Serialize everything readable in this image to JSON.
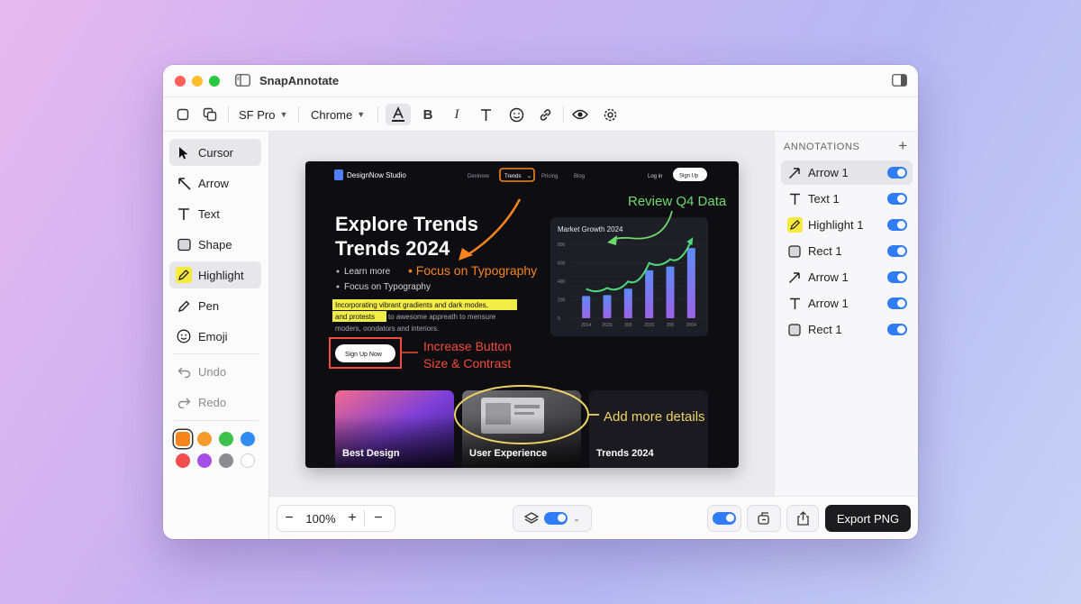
{
  "app": {
    "title": "SnapAnnotate"
  },
  "toolbar": {
    "font_family": "SF Pro",
    "browser_frame": "Chrome"
  },
  "tools": [
    {
      "label": "Cursor",
      "icon": "cursor-icon"
    },
    {
      "label": "Arrow",
      "icon": "arrow-icon"
    },
    {
      "label": "Text",
      "icon": "text-icon"
    },
    {
      "label": "Shape",
      "icon": "shape-icon"
    },
    {
      "label": "Highlight",
      "icon": "highlight-icon"
    },
    {
      "label": "Pen",
      "icon": "pen-icon"
    },
    {
      "label": "Emoji",
      "icon": "emoji-icon"
    }
  ],
  "history": {
    "undo": "Undo",
    "redo": "Redo"
  },
  "colors": {
    "swatches": [
      "#f7851d",
      "#f79a2e",
      "#3ec14a",
      "#2f8cf0",
      "#f24c4c",
      "#a64ee8",
      "#8c8c90",
      "#ffffff"
    ],
    "selected": "#f7851d",
    "accent": "#2f7cf6"
  },
  "preview": {
    "brand": "DesignNow Studio",
    "nav": [
      "Devinore",
      "Trends",
      "Pricing",
      "Blog"
    ],
    "login": "Log in",
    "signup": "Sign Up",
    "hero_title_1": "Explore Trends",
    "hero_title_2": "Trends 2024",
    "bullets": [
      "Learn more",
      "Focus on Typography"
    ],
    "body_highlight_1": "Incorporating vibrant gradients and dark modes,",
    "body_highlight_2": "and protests",
    "body_rest_1": "to awesome appreath to mensure",
    "body_rest_2": "moders, oondators and interiors.",
    "cta": "Sign Up Now",
    "chart": {
      "title": "Market Growth 2024",
      "y_ticks": [
        "800",
        "600",
        "400",
        "200",
        "0"
      ],
      "x_ticks": [
        "2014",
        "2020",
        "303",
        "2015",
        "200",
        "2004"
      ],
      "values": [
        240,
        250,
        320,
        520,
        560,
        760
      ]
    },
    "cards": [
      "Best Design",
      "User Experience",
      "Trends 2024"
    ]
  },
  "callouts": {
    "review": "Review Q4 Data",
    "typography": "• Focus on Typography",
    "button_1": "Increase Button",
    "button_2": "Size & Contrast",
    "details": "Add more details"
  },
  "annotations": {
    "header": "ANNOTATIONS",
    "add": "+",
    "items": [
      {
        "label": "Arrow 1",
        "icon": "arrow-icon",
        "visible": true
      },
      {
        "label": "Text 1",
        "icon": "text-icon",
        "visible": true
      },
      {
        "label": "Highlight 1",
        "icon": "highlight-icon",
        "visible": true
      },
      {
        "label": "Rect 1",
        "icon": "rect-icon",
        "visible": true
      },
      {
        "label": "Arrow 1",
        "icon": "arrow-icon",
        "visible": true
      },
      {
        "label": "Arrow 1",
        "icon": "text-icon",
        "visible": true
      },
      {
        "label": "Rect 1",
        "icon": "rect-icon",
        "visible": true
      }
    ]
  },
  "bottom": {
    "zoom": "100%",
    "export": "Export PNG"
  }
}
